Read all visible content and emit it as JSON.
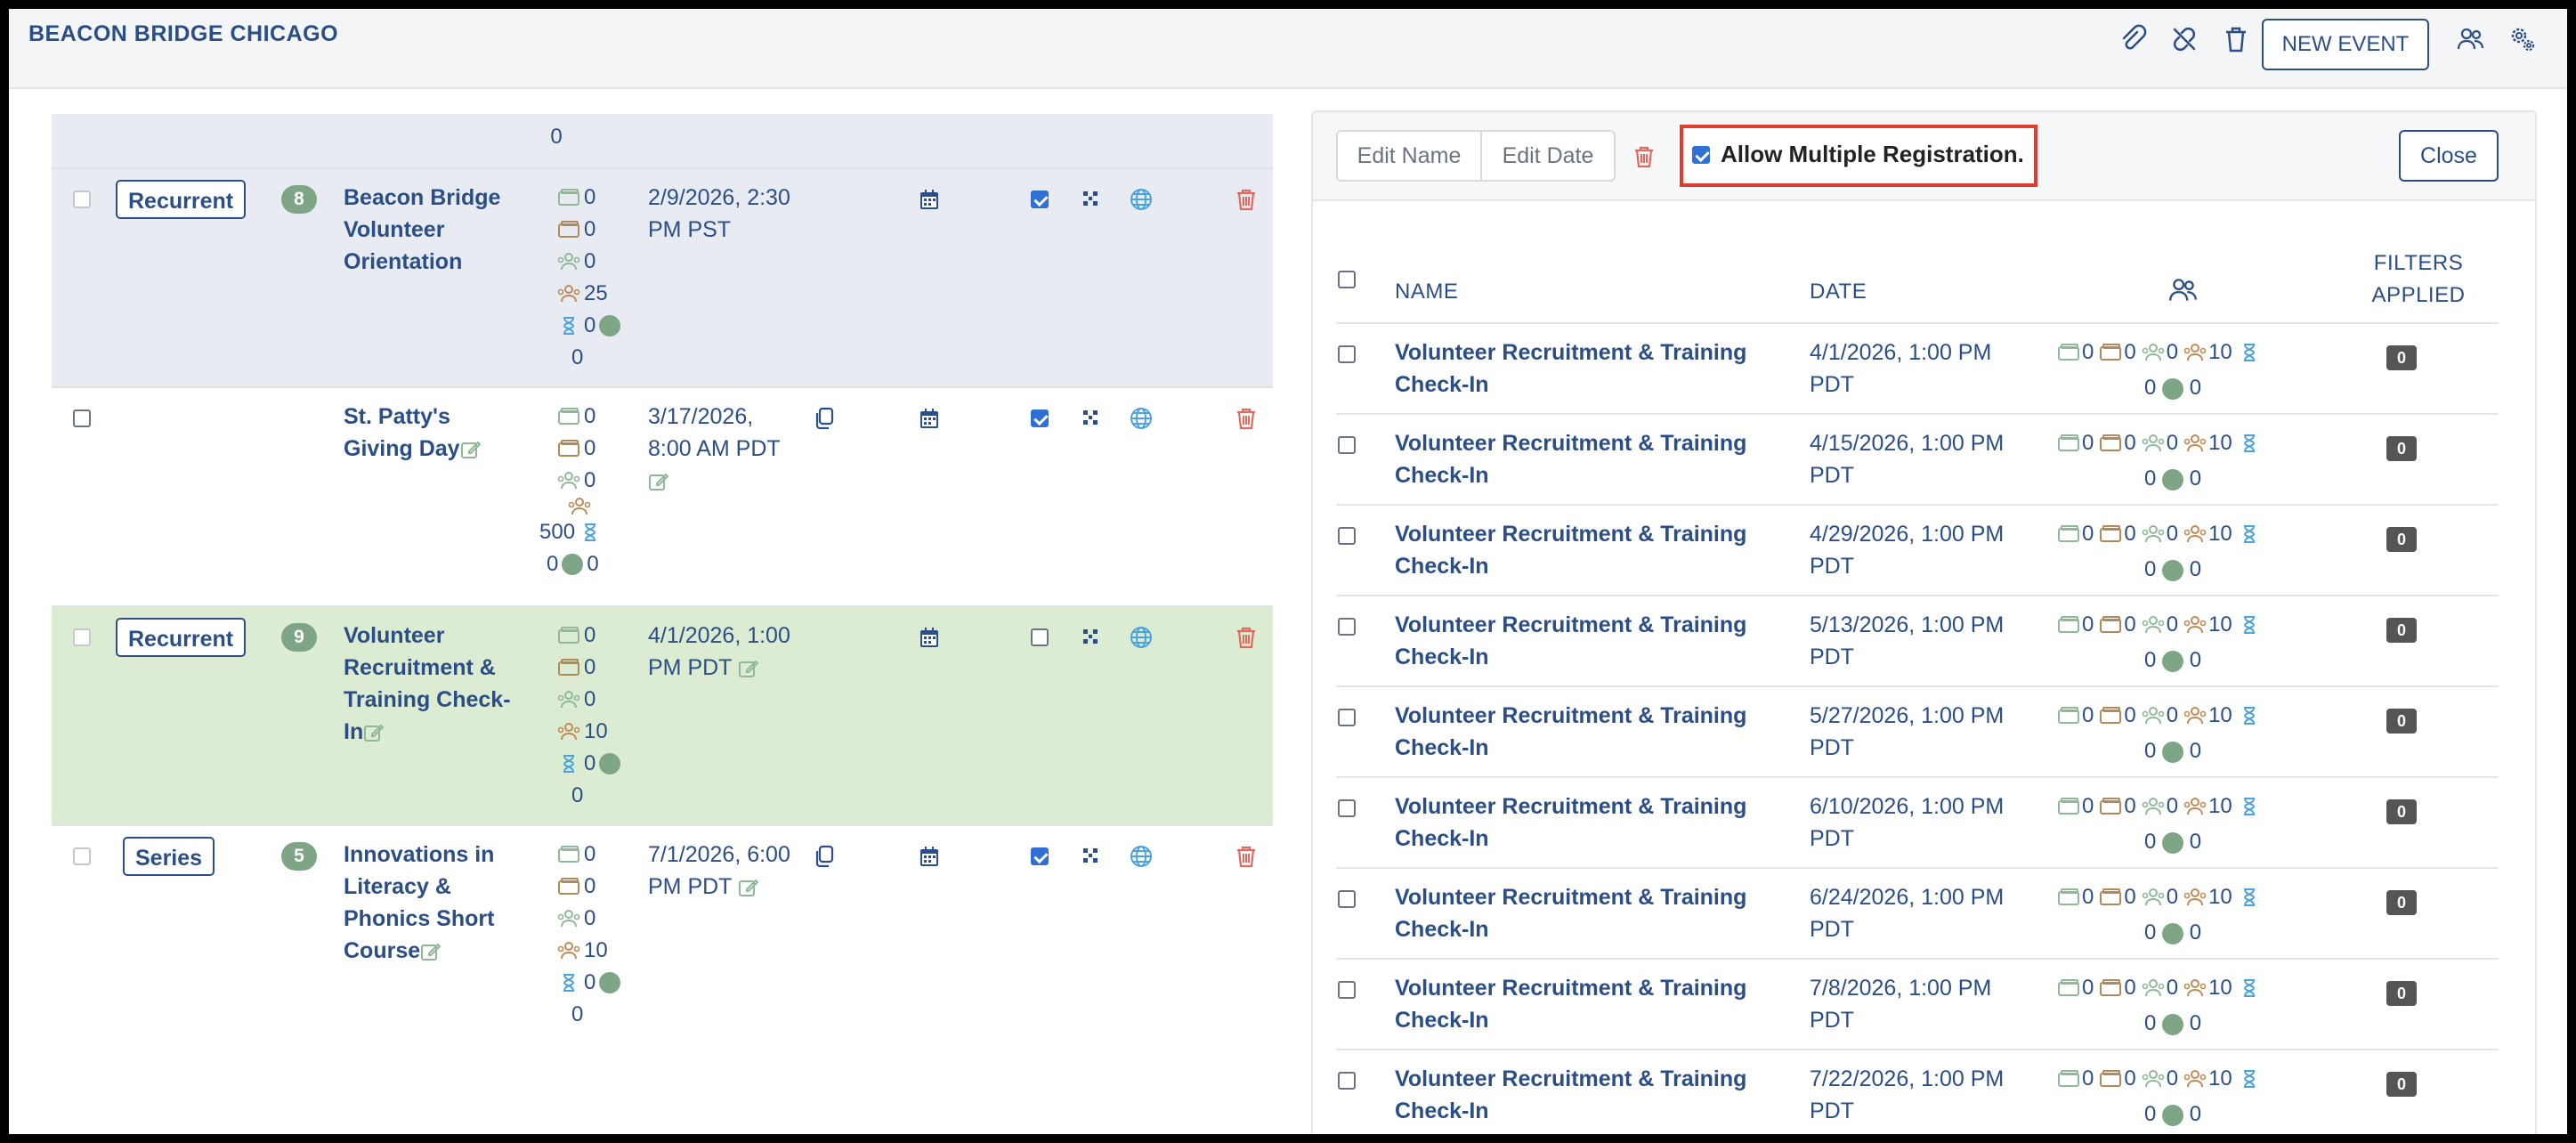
{
  "app": {
    "brand": "BEACON BRIDGE CHICAGO",
    "new_event_label": "NEW EVENT"
  },
  "left_rows": [
    {
      "stats_tail": "0"
    },
    {
      "tag": "Recurrent",
      "count": "8",
      "name": "Beacon Bridge Volunteer Orientation",
      "date": "2/9/2026, 2:30 PM PST",
      "stats": [
        "0",
        "0",
        "0",
        "25",
        "0",
        "0"
      ],
      "published": true
    },
    {
      "tag": "",
      "count": "",
      "name": "St. Patty's Giving Day",
      "date": "3/17/2026, 8:00 AM PDT",
      "stats": [
        "0",
        "0",
        "0",
        "500",
        "0",
        "0"
      ],
      "published": true
    },
    {
      "tag": "Recurrent",
      "count": "9",
      "name": "Volunteer Recruitment & Training Check-In",
      "date": "4/1/2026, 1:00 PM PDT",
      "stats": [
        "0",
        "0",
        "0",
        "10",
        "0",
        "0"
      ],
      "published": false
    },
    {
      "tag": "Series",
      "count": "5",
      "name": "Innovations in Literacy & Phonics Short Course",
      "date": "7/1/2026, 6:00 PM PDT",
      "stats": [
        "0",
        "0",
        "0",
        "10",
        "0",
        "0"
      ],
      "published": true
    }
  ],
  "panel": {
    "edit_name_label": "Edit Name",
    "edit_date_label": "Edit Date",
    "allow_multiple_label": "Allow Multiple Registration.",
    "allow_multiple_checked": true,
    "close_label": "Close",
    "headers": {
      "name": "NAME",
      "date": "DATE",
      "filters_line1": "FILTERS",
      "filters_line2": "APPLIED"
    },
    "rows": [
      {
        "name": "Volunteer Recruitment & Training Check-In",
        "date": "4/1/2026, 1:00 PM PDT",
        "s1": "0",
        "s2": "0",
        "s3": "0",
        "s4": "10",
        "s5": "0",
        "s6": "0",
        "filters": "0"
      },
      {
        "name": "Volunteer Recruitment & Training Check-In",
        "date": "4/15/2026, 1:00 PM PDT",
        "s1": "0",
        "s2": "0",
        "s3": "0",
        "s4": "10",
        "s5": "0",
        "s6": "0",
        "filters": "0"
      },
      {
        "name": "Volunteer Recruitment & Training Check-In",
        "date": "4/29/2026, 1:00 PM PDT",
        "s1": "0",
        "s2": "0",
        "s3": "0",
        "s4": "10",
        "s5": "0",
        "s6": "0",
        "filters": "0"
      },
      {
        "name": "Volunteer Recruitment & Training Check-In",
        "date": "5/13/2026, 1:00 PM PDT",
        "s1": "0",
        "s2": "0",
        "s3": "0",
        "s4": "10",
        "s5": "0",
        "s6": "0",
        "filters": "0"
      },
      {
        "name": "Volunteer Recruitment & Training Check-In",
        "date": "5/27/2026, 1:00 PM PDT",
        "s1": "0",
        "s2": "0",
        "s3": "0",
        "s4": "10",
        "s5": "0",
        "s6": "0",
        "filters": "0"
      },
      {
        "name": "Volunteer Recruitment & Training Check-In",
        "date": "6/10/2026, 1:00 PM PDT",
        "s1": "0",
        "s2": "0",
        "s3": "0",
        "s4": "10",
        "s5": "0",
        "s6": "0",
        "filters": "0"
      },
      {
        "name": "Volunteer Recruitment & Training Check-In",
        "date": "6/24/2026, 1:00 PM PDT",
        "s1": "0",
        "s2": "0",
        "s3": "0",
        "s4": "10",
        "s5": "0",
        "s6": "0",
        "filters": "0"
      },
      {
        "name": "Volunteer Recruitment & Training Check-In",
        "date": "7/8/2026, 1:00 PM PDT",
        "s1": "0",
        "s2": "0",
        "s3": "0",
        "s4": "10",
        "s5": "0",
        "s6": "0",
        "filters": "0"
      },
      {
        "name": "Volunteer Recruitment & Training Check-In",
        "date": "7/22/2026, 1:00 PM PDT",
        "s1": "0",
        "s2": "0",
        "s3": "0",
        "s4": "10",
        "s5": "0",
        "s6": "0",
        "filters": "0"
      }
    ]
  }
}
